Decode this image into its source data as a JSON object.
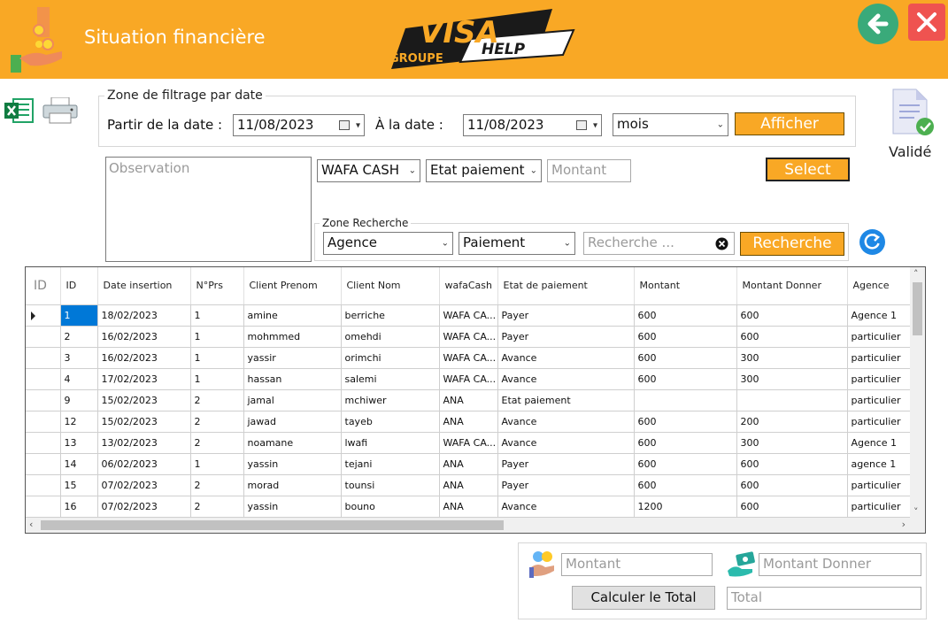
{
  "header": {
    "title": "Situation financière",
    "brand_main": "VISA",
    "brand_sub": "HELP",
    "brand_group": "GROUPE",
    "back_icon": "arrow-left-icon",
    "close_icon": "close-icon"
  },
  "toolbar": {
    "excel_icon": "excel-icon",
    "printer_icon": "printer-icon"
  },
  "date_filter": {
    "group_title": "Zone de filtrage par date",
    "from_label": "Partir de la date :",
    "from_value": "11/08/2023",
    "to_label": "À la date :",
    "to_value": "11/08/2023",
    "period_value": "mois",
    "show_button": "Afficher"
  },
  "validated": {
    "label": "Validé",
    "icon": "validated-document-icon"
  },
  "observation_placeholder": "Observation",
  "filters": {
    "wafacash_value": "WAFA CASH",
    "payment_state_value": "Etat paiement",
    "amount_placeholder": "Montant",
    "select_button": "Select"
  },
  "search": {
    "group_title": "Zone Recherche",
    "agency_value": "Agence",
    "payment_value": "Paiement",
    "placeholder": "Recherche ...",
    "button": "Recherche"
  },
  "grid": {
    "id_header": "ID",
    "columns": [
      "ID",
      "Date insertion",
      "N°Prs",
      "Client Prenom",
      "Client Nom",
      "wafaCash",
      "Etat de paiement",
      "Montant",
      "Montant Donner",
      "Agence"
    ],
    "rows": [
      [
        "1",
        "18/02/2023",
        "1",
        "amine",
        "berriche",
        "WAFA CA...",
        "Payer",
        "600",
        "600",
        "Agence 1"
      ],
      [
        "2",
        "16/02/2023",
        "1",
        "mohmmed",
        "omehdi",
        "WAFA CA...",
        "Payer",
        "600",
        "600",
        "particulier"
      ],
      [
        "3",
        "16/02/2023",
        "1",
        "yassir",
        "orimchi",
        "WAFA CA...",
        "Avance",
        "600",
        "300",
        "particulier"
      ],
      [
        "4",
        "17/02/2023",
        "1",
        "hassan",
        "salemi",
        "WAFA CA...",
        "Avance",
        "600",
        "300",
        "particulier"
      ],
      [
        "9",
        "15/02/2023",
        "2",
        "jamal",
        "mchiwer",
        "ANA",
        "Etat paiement",
        "",
        "",
        "particulier"
      ],
      [
        "12",
        "15/02/2023",
        "2",
        "jawad",
        "tayeb",
        "ANA",
        "Avance",
        "600",
        "200",
        "particulier"
      ],
      [
        "13",
        "13/02/2023",
        "2",
        "noamane",
        "lwafi",
        "WAFA CA...",
        "Avance",
        "600",
        "300",
        "Agence 1"
      ],
      [
        "14",
        "06/02/2023",
        "1",
        "yassin",
        "tejani",
        "ANA",
        "Payer",
        "600",
        "600",
        "agence 1"
      ],
      [
        "15",
        "07/02/2023",
        "2",
        "morad",
        "tounsi",
        "ANA",
        "Payer",
        "600",
        "600",
        "particulier"
      ],
      [
        "16",
        "07/02/2023",
        "2",
        "yassin",
        "bouno",
        "ANA",
        "Avance",
        "1200",
        "600",
        "particulier"
      ]
    ]
  },
  "totals": {
    "amount_placeholder": "Montant",
    "given_placeholder": "Montant Donner",
    "calc_button": "Calculer le Total",
    "total_placeholder": "Total"
  },
  "colors": {
    "header_bg": "#f9a825",
    "accent_orange": "#f9a825",
    "back_green": "#3aaa7a",
    "close_red": "#ef5350",
    "selection_blue": "#0078d7"
  }
}
